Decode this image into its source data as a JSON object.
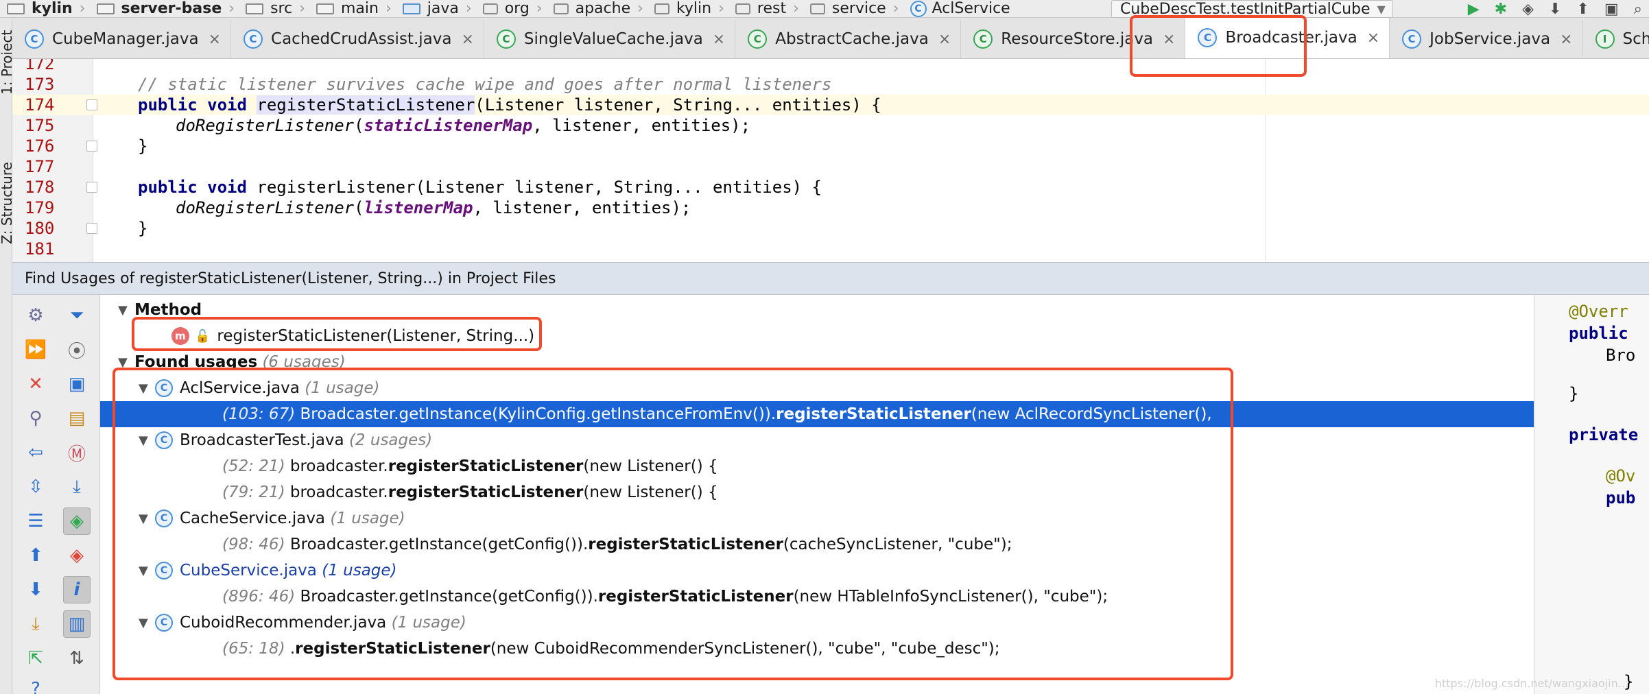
{
  "breadcrumbs": [
    {
      "label": "kylin",
      "icon": "folder",
      "bold": true
    },
    {
      "label": "server-base",
      "icon": "folder",
      "bold": true
    },
    {
      "label": "src",
      "icon": "folder"
    },
    {
      "label": "main",
      "icon": "folder"
    },
    {
      "label": "java",
      "icon": "folder-blue"
    },
    {
      "label": "org",
      "icon": "package"
    },
    {
      "label": "apache",
      "icon": "package"
    },
    {
      "label": "kylin",
      "icon": "package"
    },
    {
      "label": "rest",
      "icon": "package"
    },
    {
      "label": "service",
      "icon": "package"
    },
    {
      "label": "AclService",
      "icon": "class"
    }
  ],
  "toolbar": {
    "run_config": "CubeDescTest.testInitPartialCube"
  },
  "side_labels": {
    "project": "1: Project",
    "structure": "Z: Structure"
  },
  "tabs": [
    {
      "label": "CubeManager.java",
      "icon": "C",
      "active": false
    },
    {
      "label": "CachedCrudAssist.java",
      "icon": "C",
      "active": false
    },
    {
      "label": "SingleValueCache.java",
      "icon": "C",
      "active": false
    },
    {
      "label": "AbstractCache.java",
      "icon": "C",
      "active": false
    },
    {
      "label": "ResourceStore.java",
      "icon": "C",
      "active": false
    },
    {
      "label": "Broadcaster.java",
      "icon": "C",
      "active": true
    },
    {
      "label": "JobService.java",
      "icon": "C",
      "active": false
    },
    {
      "label": "Scheduler.java",
      "icon": "I",
      "active": false
    }
  ],
  "editor": {
    "lines": [
      {
        "n": "172",
        "text": ""
      },
      {
        "n": "173",
        "text": "// static listener survives cache wipe and goes after normal listeners"
      },
      {
        "n": "174",
        "text": "public void registerStaticListener(Listener listener, String... entities) {"
      },
      {
        "n": "175",
        "text": "doRegisterListener(staticListenerMap, listener, entities);"
      },
      {
        "n": "176",
        "text": "}"
      },
      {
        "n": "177",
        "text": ""
      },
      {
        "n": "178",
        "text": "public void registerListener(Listener listener, String... entities) {"
      },
      {
        "n": "179",
        "text": "doRegisterListener(listenerMap, listener, entities);"
      },
      {
        "n": "180",
        "text": "}"
      },
      {
        "n": "181",
        "text": ""
      }
    ]
  },
  "find": {
    "title": "Find Usages of registerStaticListener(Listener, String...) in Project Files",
    "method_group": "Method",
    "method_sig": "registerStaticListener(Listener, String...)",
    "found_label": "Found usages",
    "found_count": "(6 usages)",
    "files": [
      {
        "name": "AclService.java",
        "count": "(1 usage)"
      },
      {
        "name": "BroadcasterTest.java",
        "count": "(2 usages)"
      },
      {
        "name": "CacheService.java",
        "count": "(1 usage)"
      },
      {
        "name": "CubeService.java",
        "count": "(1 usage)"
      },
      {
        "name": "CuboidRecommender.java",
        "count": "(1 usage)"
      }
    ],
    "usages": [
      {
        "loc": "(103: 67)",
        "pre": "Broadcaster.getInstance(KylinConfig.getInstanceFromEnv()).",
        "method": "registerStaticListener",
        "post": "(new AclRecordSyncListener(),"
      },
      {
        "loc": "(52: 21)",
        "pre": "broadcaster.",
        "method": "registerStaticListener",
        "post": "(new Listener() {"
      },
      {
        "loc": "(79: 21)",
        "pre": "broadcaster.",
        "method": "registerStaticListener",
        "post": "(new Listener() {"
      },
      {
        "loc": "(98: 46)",
        "pre": "Broadcaster.getInstance(getConfig()).",
        "method": "registerStaticListener",
        "post": "(cacheSyncListener, \"cube\");"
      },
      {
        "loc": "(896: 46)",
        "pre": "Broadcaster.getInstance(getConfig()).",
        "method": "registerStaticListener",
        "post": "(new HTableInfoSyncListener(), \"cube\");"
      },
      {
        "loc": "(65: 18)",
        "pre": ".",
        "method": "registerStaticListener",
        "post": "(new CuboidRecommenderSyncListener(), \"cube\", \"cube_desc\");"
      }
    ]
  },
  "preview": {
    "l1": "@Overr",
    "l2": "public",
    "l3": "Bro",
    "l4": "}",
    "l5": "private",
    "l6": "@Ov",
    "l7": "pub",
    "l8": "}"
  },
  "watermark": "https://blog.csdn.net/wangxiaojin..."
}
